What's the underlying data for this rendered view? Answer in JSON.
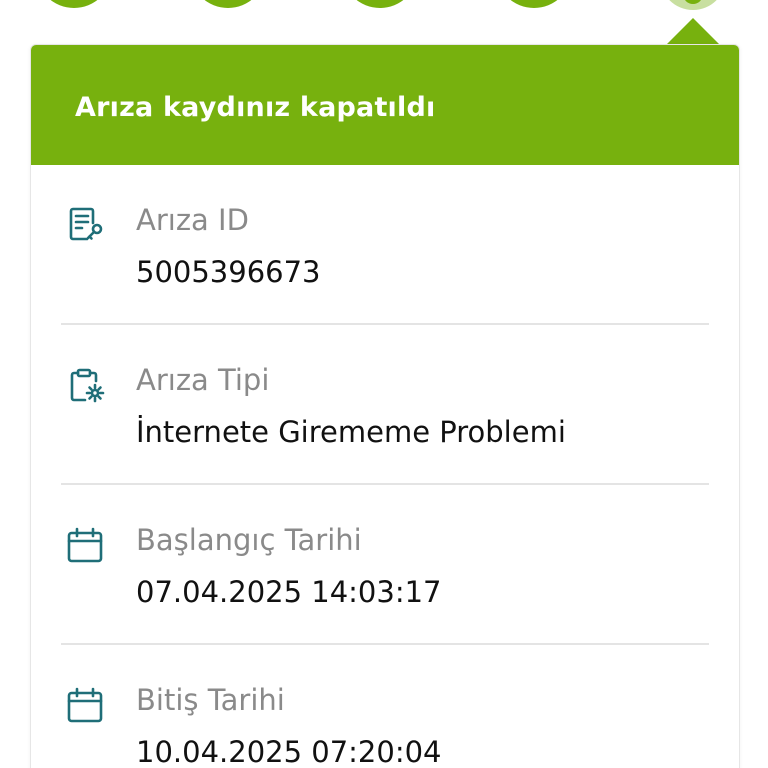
{
  "colors": {
    "brand_green": "#77b10e",
    "brand_green_light": "#c8dfa0",
    "icon_teal": "#1f6e78",
    "label_gray": "#8a8a8a",
    "value_dark": "#111111"
  },
  "header": {
    "title": "Arıza kaydınız kapatıldı"
  },
  "rows": [
    {
      "icon": "document-key-icon",
      "label": "Arıza ID",
      "value": "5005396673"
    },
    {
      "icon": "clipboard-gear-icon",
      "label": "Arıza Tipi",
      "value": "İnternete Girememe Problemi"
    },
    {
      "icon": "calendar-icon",
      "label": "Başlangıç Tarihi",
      "value": "07.04.2025 14:03:17"
    },
    {
      "icon": "calendar-icon",
      "label": "Bitiş Tarihi",
      "value": "10.04.2025 07:20:04"
    }
  ]
}
